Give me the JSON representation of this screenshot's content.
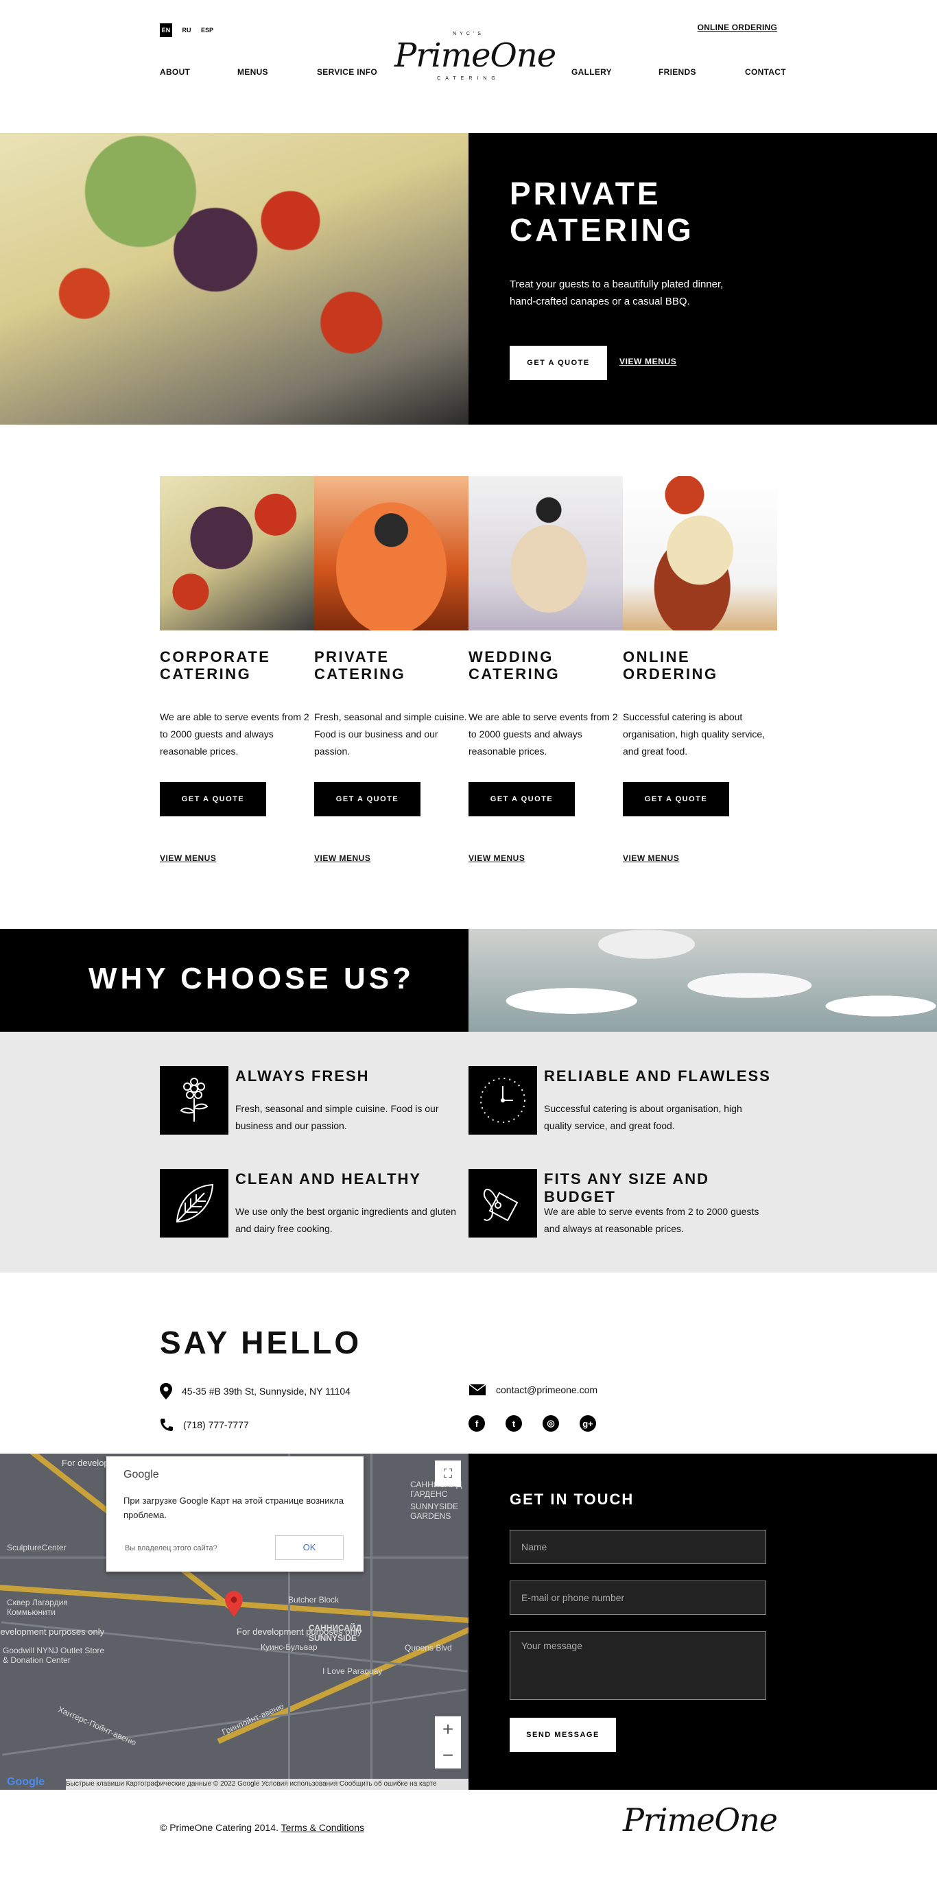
{
  "header": {
    "languages": [
      "EN",
      "RU",
      "ESP"
    ],
    "active_language": "EN",
    "online_ordering": "ONLINE ORDERING",
    "nav_left": [
      "ABOUT",
      "MENUS",
      "SERVICE INFO"
    ],
    "nav_right": [
      "GALLERY",
      "FRIENDS",
      "CONTACT"
    ],
    "logo_top": "NYC'S",
    "logo": "PrimeOne",
    "logo_bottom": "CATERING"
  },
  "hero": {
    "title_line1": "PRIVATE",
    "title_line2": "CATERING",
    "text": "Treat your guests to a beautifully plated dinner, hand-crafted canapes or a casual BBQ.",
    "quote_button": "GET A QUOTE",
    "menus_link": "VIEW MENUS"
  },
  "services": [
    {
      "title_line1": "CORPORATE",
      "title_line2": "CATERING",
      "text": "We are able to serve events from 2 to 2000 guests and always reasonable prices.",
      "button": "GET A QUOTE",
      "link": "VIEW MENUS"
    },
    {
      "title_line1": "PRIVATE",
      "title_line2": "CATERING",
      "text": "Fresh, seasonal and simple cuisine. Food is our business and our passion.",
      "button": "GET A QUOTE",
      "link": "VIEW MENUS"
    },
    {
      "title_line1": "WEDDING",
      "title_line2": "CATERING",
      "text": "We are able to serve events from 2 to 2000 guests and always reasonable prices.",
      "button": "GET A QUOTE",
      "link": "VIEW MENUS"
    },
    {
      "title_line1": "ONLINE",
      "title_line2": "ORDERING",
      "text": "Successful catering is about organisation, high quality service, and great food.",
      "button": "GET A QUOTE",
      "link": "VIEW MENUS"
    }
  ],
  "why": {
    "title": "WHY CHOOSE US?",
    "features": [
      {
        "title": "ALWAYS FRESH",
        "text": "Fresh, seasonal and simple cuisine. Food is our business and our passion.",
        "icon": "flower-icon"
      },
      {
        "title": "RELIABLE AND FLAWLESS",
        "text": "Successful catering is about organisation, high quality service, and great food.",
        "icon": "clock-icon"
      },
      {
        "title": "CLEAN AND HEALTHY",
        "text": "We use only the best organic ingredients and gluten and dairy free cooking.",
        "icon": "leaf-icon"
      },
      {
        "title": "FITS ANY SIZE AND BUDGET",
        "text": "We are able to serve events from 2 to 2000 guests and always at reasonable prices.",
        "icon": "price-tag-icon"
      }
    ]
  },
  "hello": {
    "title": "SAY HELLO",
    "address": "45-35 #B 39th St, Sunnyside, NY 11104",
    "email": "contact@primeone.com",
    "phone": "(718) 777-7777",
    "socials": [
      "facebook-icon",
      "twitter-icon",
      "instagram-icon",
      "google-plus-icon"
    ]
  },
  "map": {
    "brand": "Google",
    "error": "При загрузке Google Карт на этой странице возникла проблема.",
    "owner": "Вы владелец этого сайта?",
    "ok": "OK",
    "dev_text": "For development purposes only",
    "labels": [
      "САННИСАЙД ГАРДЕНС",
      "SUNNYSIDE GARDENS",
      "Butcher Block",
      "САННИСАЙД",
      "SUNNYSIDE",
      "Queens Blvd",
      "I Love Paraguay",
      "SculptureCenter",
      "Сквер Лагардия Коммьюнити",
      "Goodwill NYNJ Outlet Store & Donation Center",
      "Хантерс-Пойнт-авеню",
      "Гринпойнт-авеню",
      "Куинс-Бульвар"
    ],
    "footer": "Быстрые клавиши   Картографические данные © 2022 Google   Условия использования   Сообщить об ошибке на карте",
    "logo": "Google",
    "zoom_in": "+",
    "zoom_out": "−"
  },
  "form": {
    "title": "GET IN TOUCH",
    "name_placeholder": "Name",
    "contact_placeholder": "E-mail or phone number",
    "message_placeholder": "Your message",
    "send": "SEND MESSAGE"
  },
  "footer": {
    "copyright": "© PrimeOne Catering 2014.",
    "terms": "Terms & Conditions",
    "logo": "PrimeOne"
  }
}
